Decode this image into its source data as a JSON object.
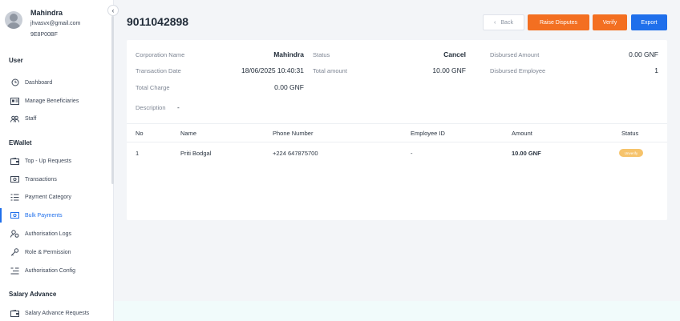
{
  "profile": {
    "name": "Mahindra",
    "email": "jhvasvx@gmail.com",
    "code": "9E8P00BF"
  },
  "sidebar": {
    "sections": [
      {
        "title": "User",
        "items": [
          {
            "label": "Dashboard",
            "icon": "clock-icon"
          },
          {
            "label": "Manage Beneficiaries",
            "icon": "id-card-icon"
          },
          {
            "label": "Staff",
            "icon": "users-icon"
          }
        ]
      },
      {
        "title": "EWallet",
        "items": [
          {
            "label": "Top - Up Requests",
            "icon": "wallet-icon"
          },
          {
            "label": "Transactions",
            "icon": "money-icon"
          },
          {
            "label": "Payment Category",
            "icon": "list-icon"
          },
          {
            "label": "Bulk Payments",
            "icon": "money-icon",
            "active": true
          },
          {
            "label": "Authorisation Logs",
            "icon": "user-cog-icon"
          },
          {
            "label": "Role & Permission",
            "icon": "key-icon"
          },
          {
            "label": "Authorisation Config",
            "icon": "settings-list-icon"
          }
        ]
      },
      {
        "title": "Salary Advance",
        "items": [
          {
            "label": "Salary Advance Requests",
            "icon": "wallet-icon"
          }
        ]
      }
    ]
  },
  "header": {
    "title": "9011042898"
  },
  "actions": {
    "back": "Back",
    "raise": "Raise Disputes",
    "verify": "Verify",
    "export": "Export"
  },
  "details": {
    "corporation_name_label": "Corporation Name",
    "corporation_name": "Mahindra",
    "transaction_date_label": "Transaction Date",
    "transaction_date": "18/06/2025 10:40:31",
    "total_charge_label": "Total Charge",
    "total_charge": "0.00 GNF",
    "description_label": "Description",
    "description": "-",
    "status_label": "Status",
    "status": "Cancel",
    "total_amount_label": "Total amount",
    "total_amount": "10.00 GNF",
    "disbursed_amount_label": "Disbursed Amount",
    "disbursed_amount": "0.00 GNF",
    "disbursed_employee_label": "Disbursed Employee",
    "disbursed_employee": "1"
  },
  "table": {
    "headers": {
      "no": "No",
      "name": "Name",
      "phone": "Phone Number",
      "employee_id": "Employee ID",
      "amount": "Amount",
      "status": "Status"
    },
    "rows": [
      {
        "no": "1",
        "name": "Priti Bodgal",
        "phone": "+224 647875700",
        "employee_id": "-",
        "amount": "10.00 GNF",
        "status": "Unverify"
      }
    ]
  },
  "colors": {
    "accent": "#1f6feb",
    "orange": "#f36f21",
    "badge": "#f6c36b"
  }
}
